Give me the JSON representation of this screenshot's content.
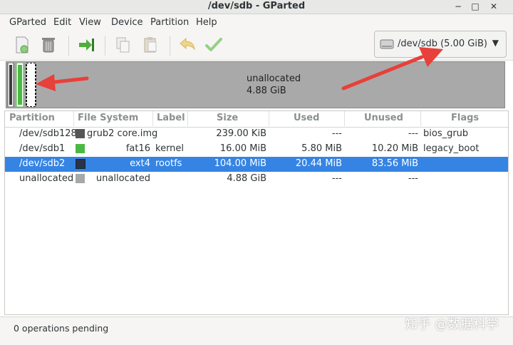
{
  "window": {
    "title": "/dev/sdb - GParted",
    "min_glyph": "−",
    "max_glyph": "□",
    "close_glyph": "✕"
  },
  "menu": [
    "GParted",
    "Edit",
    "View",
    "Device",
    "Partition",
    "Help"
  ],
  "device_selector": {
    "label": "/dev/sdb (5.00 GiB)",
    "arrow": "▼"
  },
  "disk_map": {
    "label": "unallocated",
    "size": "4.88 GiB"
  },
  "table": {
    "headers": [
      "Partition",
      "File System",
      "Label",
      "Size",
      "Used",
      "Unused",
      "Flags"
    ],
    "rows": [
      {
        "partition": "/dev/sdb128",
        "color": "#555555",
        "fs": "grub2 core.img",
        "label": "",
        "size": "239.00 KiB",
        "used": "---",
        "unused": "---",
        "flags": "bios_grub"
      },
      {
        "partition": "/dev/sdb1",
        "color": "#4cb844",
        "fs": "fat16",
        "label": "kernel",
        "size": "16.00 MiB",
        "used": "5.80 MiB",
        "unused": "10.20 MiB",
        "flags": "legacy_boot"
      },
      {
        "partition": "/dev/sdb2",
        "color": "#28334a",
        "fs": "ext4",
        "label": "rootfs",
        "size": "104.00 MiB",
        "used": "20.44 MiB",
        "unused": "83.56 MiB",
        "flags": ""
      },
      {
        "partition": "unallocated",
        "color": "#a8a8a8",
        "fs": "unallocated",
        "label": "",
        "size": "4.88 GiB",
        "used": "---",
        "unused": "---",
        "flags": ""
      }
    ]
  },
  "status": "0 operations pending",
  "watermark": "知乎 @数据科学",
  "colors": {
    "selection": "#3584e4",
    "annotation_arrow": "#e8403a"
  }
}
